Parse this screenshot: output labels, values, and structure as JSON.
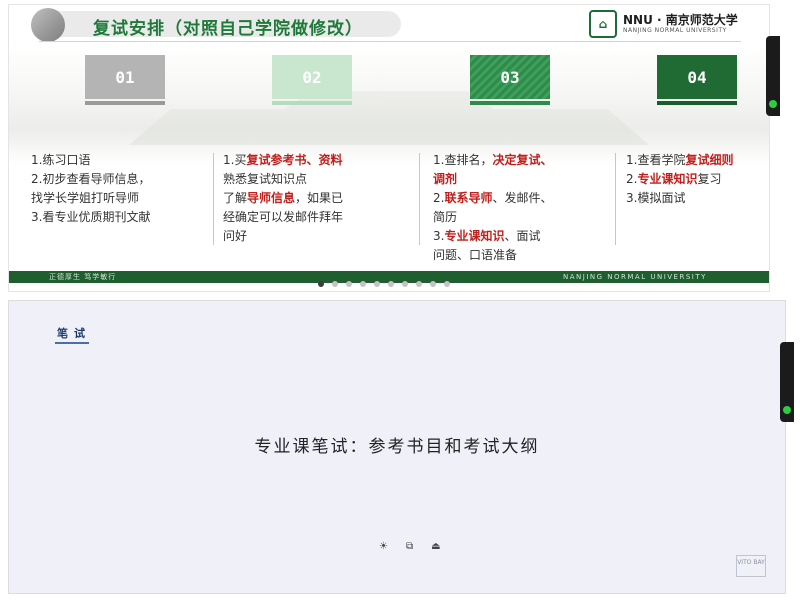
{
  "slide1": {
    "title": "复试安排（对照自己学院做修改）",
    "logo": {
      "badge": "⌂",
      "main": "NNU · 南京师范大学",
      "sub": "NANJING NORMAL UNIVERSITY"
    },
    "steps": [
      "01",
      "02",
      "03",
      "04"
    ],
    "col1": [
      {
        "a": "1.练习口语"
      },
      {
        "a": "2.初步查看导师信息，"
      },
      {
        "a": "找学长学姐打听导师"
      },
      {
        "a": "3.看专业优质期刊文献"
      }
    ],
    "col2": [
      {
        "a": "1.买",
        "r": "复试参考书、资料",
        "b": ""
      },
      {
        "a": "熟悉复试知识点",
        "r": "",
        "b": ""
      },
      {
        "a": "了解",
        "r": "导师信息",
        "b": "，如果已"
      },
      {
        "a": "经确定可以发邮件拜年",
        "r": "",
        "b": ""
      },
      {
        "a": "问好",
        "r": "",
        "b": ""
      }
    ],
    "col3": [
      {
        "a": "1.查排名，",
        "r": "决定复试、",
        "b": ""
      },
      {
        "a": "",
        "r": "调剂",
        "b": ""
      },
      {
        "a": "2.",
        "r": "联系导师",
        "b": "、发邮件、"
      },
      {
        "a": "简历",
        "r": "",
        "b": ""
      },
      {
        "a": "3.",
        "r": "专业课知识",
        "b": "、面试"
      },
      {
        "a": "问题、口语准备",
        "r": "",
        "b": ""
      }
    ],
    "col4": [
      {
        "a": "1.查看学院",
        "r": "复试细则",
        "b": ""
      },
      {
        "a": "2.",
        "r": "专业课知识",
        "b": "复习"
      },
      {
        "a": "3.模拟面试",
        "r": "",
        "b": ""
      }
    ],
    "footer_left": "正德厚生  笃学敏行",
    "footer_right": "NANJING NORMAL UNIVERSITY"
  },
  "slide2": {
    "tag": "笔试",
    "main_text": "专业课笔试：参考书目和考试大纲",
    "icons": [
      "☀",
      "⧉",
      "⏏"
    ],
    "badge": "VITO BAY"
  },
  "colors": {
    "green": "#1f7a3a",
    "dark_green": "#1f5e2f",
    "red": "#c0201d",
    "navy": "#1f3b6e"
  }
}
